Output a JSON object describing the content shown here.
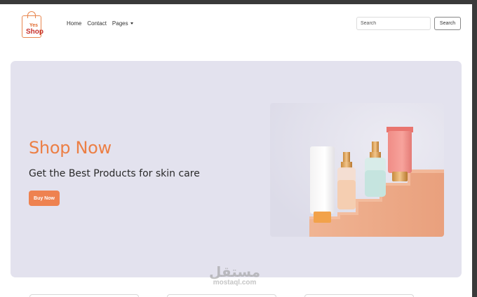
{
  "navbar": {
    "logo": {
      "small_text": "Yes",
      "big_text": "Shop"
    },
    "links": [
      {
        "label": "Home"
      },
      {
        "label": "Contact"
      },
      {
        "label": "Pages"
      }
    ],
    "search": {
      "placeholder": "Search",
      "button_label": "Search"
    }
  },
  "hero": {
    "title": "Shop Now",
    "subtitle": "Get the Best Products for skin care",
    "button_label": "Buy Now",
    "background": "#e3e2ee",
    "accent": "#ec7f45"
  },
  "watermark": {
    "logo_text": "مستقل",
    "url": "mostaql.com"
  }
}
